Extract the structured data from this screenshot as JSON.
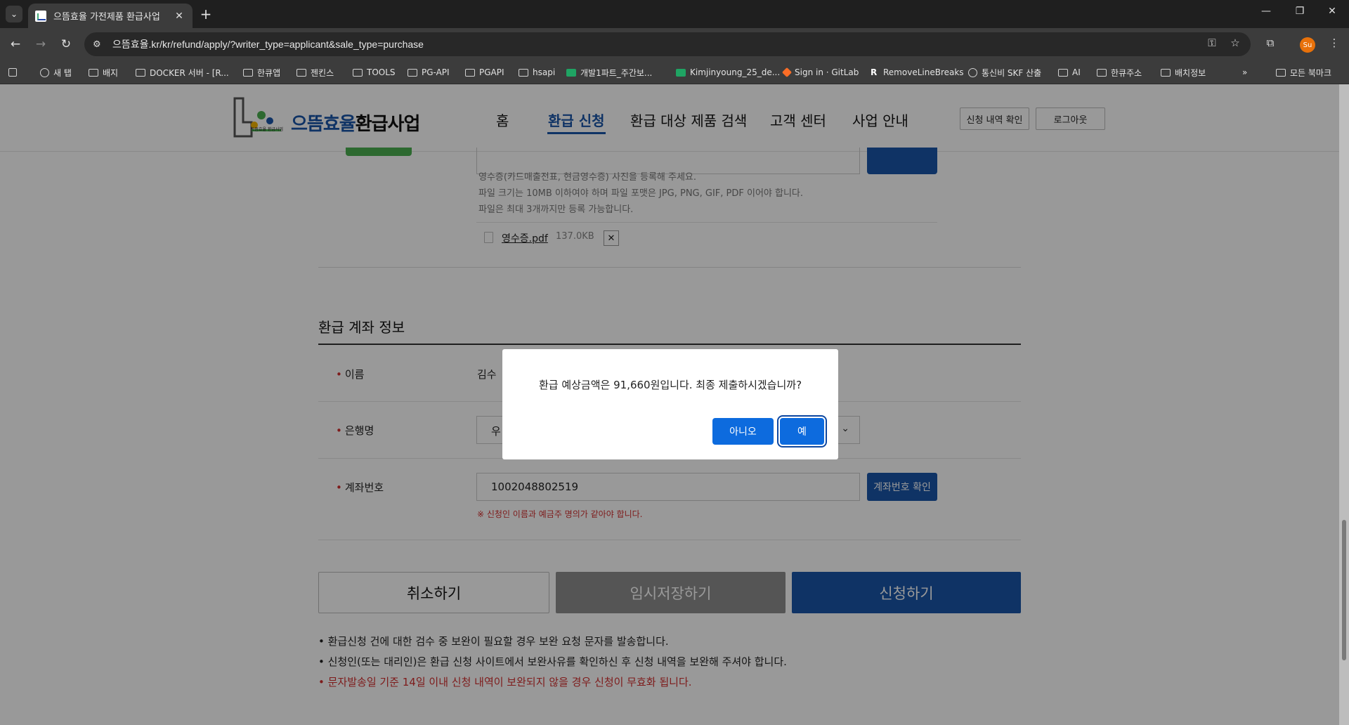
{
  "browser": {
    "tab_title": "으뜸효율 가전제품 환급사업",
    "url": "으뜸효율.kr/kr/refund/apply/?writer_type=applicant&sale_type=purchase",
    "profile_initial": "Su",
    "bookmarks": [
      {
        "label": "새 탭",
        "icon": "globe-icon"
      },
      {
        "label": "배지",
        "icon": "folder-icon"
      },
      {
        "label": "DOCKER 서버 - [R...",
        "icon": "folder-icon"
      },
      {
        "label": "한큐앱",
        "icon": "folder-icon"
      },
      {
        "label": "젠킨스",
        "icon": "folder-icon"
      },
      {
        "label": "TOOLS",
        "icon": "folder-icon"
      },
      {
        "label": "PG-API",
        "icon": "folder-icon"
      },
      {
        "label": "PGAPI",
        "icon": "folder-icon"
      },
      {
        "label": "hsapi",
        "icon": "folder-icon"
      },
      {
        "label": "개발1파트_주간보...",
        "icon": "sheets-icon"
      },
      {
        "label": "Kimjinyoung_25_de...",
        "icon": "sheets-icon"
      },
      {
        "label": "Sign in · GitLab",
        "icon": "gitlab-icon"
      },
      {
        "label": "RemoveLineBreaks",
        "icon": "r-icon"
      },
      {
        "label": "통신비 SKF 산출",
        "icon": "globe-icon"
      },
      {
        "label": "AI",
        "icon": "folder-icon"
      },
      {
        "label": "한큐주소",
        "icon": "folder-icon"
      },
      {
        "label": "배치정보",
        "icon": "folder-icon"
      }
    ],
    "all_bookmarks": "모든 북마크",
    "more": "»"
  },
  "site": {
    "logo_blue": "으뜸효율",
    "logo_dark": "환급사업",
    "logo_badge": "으뜸효율 환급사업",
    "nav": [
      "홈",
      "환급 신청",
      "환급 대상 제품 검색",
      "고객 센터",
      "사업 안내"
    ],
    "active_nav": "환급 신청",
    "btn_history": "신청 내역 확인",
    "btn_logout": "로그아웃"
  },
  "upload": {
    "help_lines": [
      "영수증(카드매출전표, 현금영수증) 사진을 등록해 주세요.",
      "파일 크기는 10MB 이하여야 하며 파일 포맷은 JPG, PNG, GIF, PDF 이어야 합니다.",
      "파일은 최대 3개까지만 등록 가능합니다."
    ],
    "file_name": "영수증.pdf",
    "file_size": "137.0KB",
    "remove": "✕"
  },
  "account": {
    "section_title": "환급 계좌 정보",
    "name_label": "이름",
    "name_value": "김수",
    "bank_label": "은행명",
    "bank_value": "우",
    "number_label": "계좌번호",
    "number_value": "1002048802519",
    "verify_btn": "계좌번호 확인",
    "note": "※ 신청인 이름과 예금주 명의가 같아야 합니다.",
    "req_mark": "•"
  },
  "actions": {
    "cancel": "취소하기",
    "save": "임시저장하기",
    "submit": "신청하기"
  },
  "notices": [
    {
      "text": "• 환급신청 건에 대한 검수 중 보완이 필요할 경우 보완 요청 문자를 발송합니다.",
      "color": "#222222"
    },
    {
      "text": "• 신청인(또는 대리인)은 환급 신청 사이트에서 보완사유를 확인하신 후 신청 내역을 보완해 주셔야 합니다.",
      "color": "#222222"
    },
    {
      "text": "• 문자발송일 기준 14일 이내 신청 내역이 보완되지 않을 경우 신청이 무효화 됩니다.",
      "color": "#d32f2f"
    }
  ],
  "modal": {
    "message": "환급 예상금액은 91,660원입니다. 최종 제출하시겠습니까?",
    "no": "아니오",
    "yes": "예"
  },
  "colors": {
    "brand_blue": "#1a55a8",
    "modal_blue": "#0d6bde",
    "error_red": "#d32f2f"
  }
}
